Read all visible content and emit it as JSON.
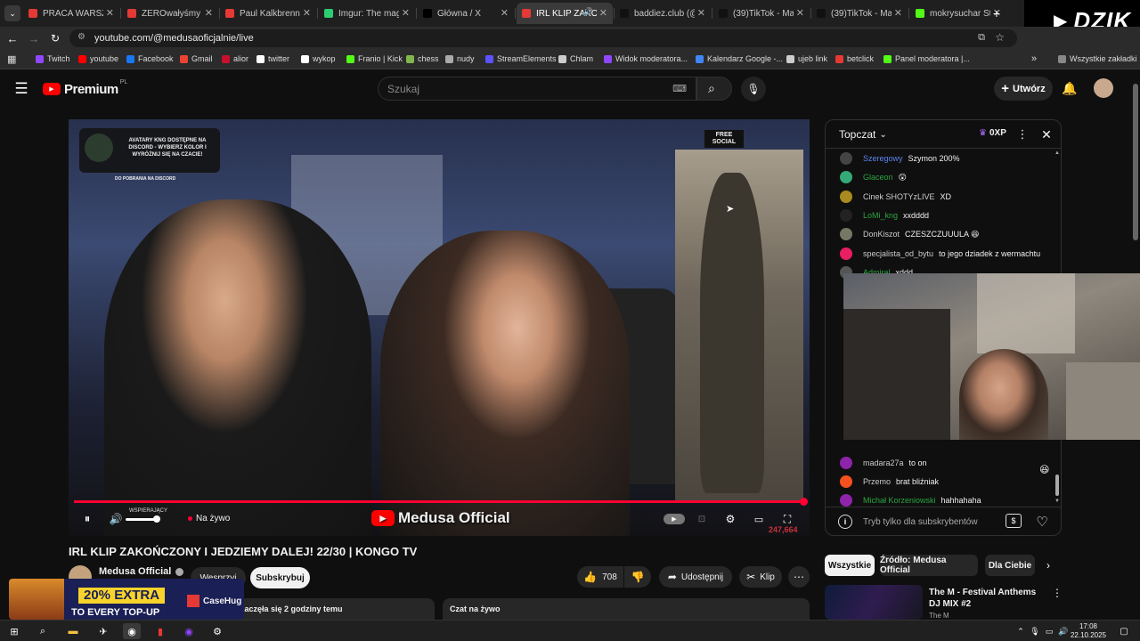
{
  "tabs": [
    {
      "label": "PRACA WARSZAWA",
      "color": "#e53935"
    },
    {
      "label": "ZEROwałyśmy KL",
      "color": "#e53935"
    },
    {
      "label": "Paul Kalkbrenner",
      "color": "#e53935"
    },
    {
      "label": "Imgur: The magic",
      "color": "#2ecc71"
    },
    {
      "label": "Główna / X",
      "color": "#000000"
    },
    {
      "label": "IRL KLIP ZAKO",
      "color": "#e53935"
    },
    {
      "label": "baddiez.club (@b",
      "color": "#111111"
    },
    {
      "label": "(39)TikTok - Make",
      "color": "#111111"
    },
    {
      "label": "(39)TikTok - Make",
      "color": "#111111"
    },
    {
      "label": "mokrysuchar Stre",
      "color": "#53fc18"
    }
  ],
  "overlay_logo": "DZIK",
  "address": "youtube.com/@medusaoficjalnie/live",
  "bookmarks": [
    {
      "label": "Twitch",
      "color": "#9146ff"
    },
    {
      "label": "youtube",
      "color": "#ff0000"
    },
    {
      "label": "Facebook",
      "color": "#1877f2"
    },
    {
      "label": "Gmail",
      "color": "#ea4335"
    },
    {
      "label": "alior",
      "color": "#c8102e"
    },
    {
      "label": "twitter",
      "color": "#ffffff"
    },
    {
      "label": "wykop",
      "color": "#ffffff"
    },
    {
      "label": "Franio | Kick",
      "color": "#53fc18"
    },
    {
      "label": "chess",
      "color": "#81b64c"
    },
    {
      "label": "nudy",
      "color": "#aaaaaa"
    },
    {
      "label": "StreamElements",
      "color": "#5b53ff"
    },
    {
      "label": "Chlam",
      "color": "#cccccc"
    },
    {
      "label": "Widok moderatora...",
      "color": "#9146ff"
    },
    {
      "label": "Kalendarz Google -...",
      "color": "#4285f4"
    },
    {
      "label": "ujeb link",
      "color": "#cccccc"
    },
    {
      "label": "betclick",
      "color": "#e53935"
    },
    {
      "label": "Panel moderatora |...",
      "color": "#53fc18"
    }
  ],
  "all_bookmarks": "Wszystkie zakładki",
  "yt": {
    "premium": "Premium",
    "region": "PL",
    "search_placeholder": "Szukaj",
    "create": "Utwórz"
  },
  "video": {
    "overlay_text": "AVATARY KNG DOSTĘPNE NA DISCORD - WYBIERZ KOLOR I WYRÓŻNIJ SIĘ NA CZACIE!",
    "overlay_sub": "DO POBRANIA NA DISCORD",
    "live": "Na żywo",
    "channel_watermark": "Medusa Official",
    "badge": "WSPIERAJĄCY",
    "free_social": "FREE SOCIAL",
    "counter": "247,664",
    "progress": 1.0
  },
  "chat": {
    "mode": "Topczat",
    "xp": "0XP",
    "messages": [
      {
        "author": "Szeregowy",
        "text": "Szymon 200%",
        "color": "#5e84f1",
        "avatar": "#444"
      },
      {
        "author": "Glaceon",
        "text": "😲",
        "color": "#2ba640",
        "avatar": "#3a7"
      },
      {
        "author": "Cinek SHOTYzLIVE",
        "text": "XD",
        "color": "#cccccc",
        "avatar": "#a98a20"
      },
      {
        "author": "LoMi_kng",
        "text": "xxdddd",
        "color": "#2ba640",
        "avatar": "#222"
      },
      {
        "author": "DonKiszot",
        "text": "CZESZCZUUULA 😆",
        "color": "#cccccc",
        "avatar": "#776"
      },
      {
        "author": "specjalista_od_bytu",
        "text": "to jego dziadek z wermachtu",
        "color": "#cccccc",
        "avatar": "#e91e63"
      },
      {
        "author": "Admiral",
        "text": "xddd",
        "color": "#2ba640",
        "avatar": "#555"
      },
      {
        "author": "madara27a",
        "text": "to on",
        "color": "#cccccc",
        "avatar": "#8e24aa"
      },
      {
        "author": "Przemo",
        "text": "brat bliźniak",
        "color": "#cccccc",
        "avatar": "#f4511e"
      },
      {
        "author": "Michał Korzeniowski",
        "text": "hahhahaha",
        "color": "#2ba640",
        "avatar": "#8e24aa"
      }
    ],
    "input_placeholder": "Tryb tylko dla subskrybentów"
  },
  "title": "IRL KLIP ZAKOŃCZONY I JEDZIEMY DALEJ! 22/30 | KONGO TV",
  "channel": {
    "name": "Medusa Official",
    "support": "Wesprzyj",
    "subscribe": "Subskrybuj"
  },
  "actions": {
    "likes": "708",
    "share": "Udostępnij",
    "clip": "Klip"
  },
  "description_start": "zaczęła się 2 godziny temu",
  "live_chat_label": "Czat na żywo",
  "filters": [
    "Wszystkie",
    "Źródło: Medusa Official",
    "Dla Ciebie"
  ],
  "recommended": {
    "title": "The M - Festival Anthems DJ MIX #2",
    "channel": "The M"
  },
  "ad": {
    "headline": "20% EXTRA",
    "sub": "TO EVERY TOP-UP",
    "brand": "CaseHug"
  },
  "clock": {
    "time": "17:08",
    "date": "22.10.2025"
  }
}
